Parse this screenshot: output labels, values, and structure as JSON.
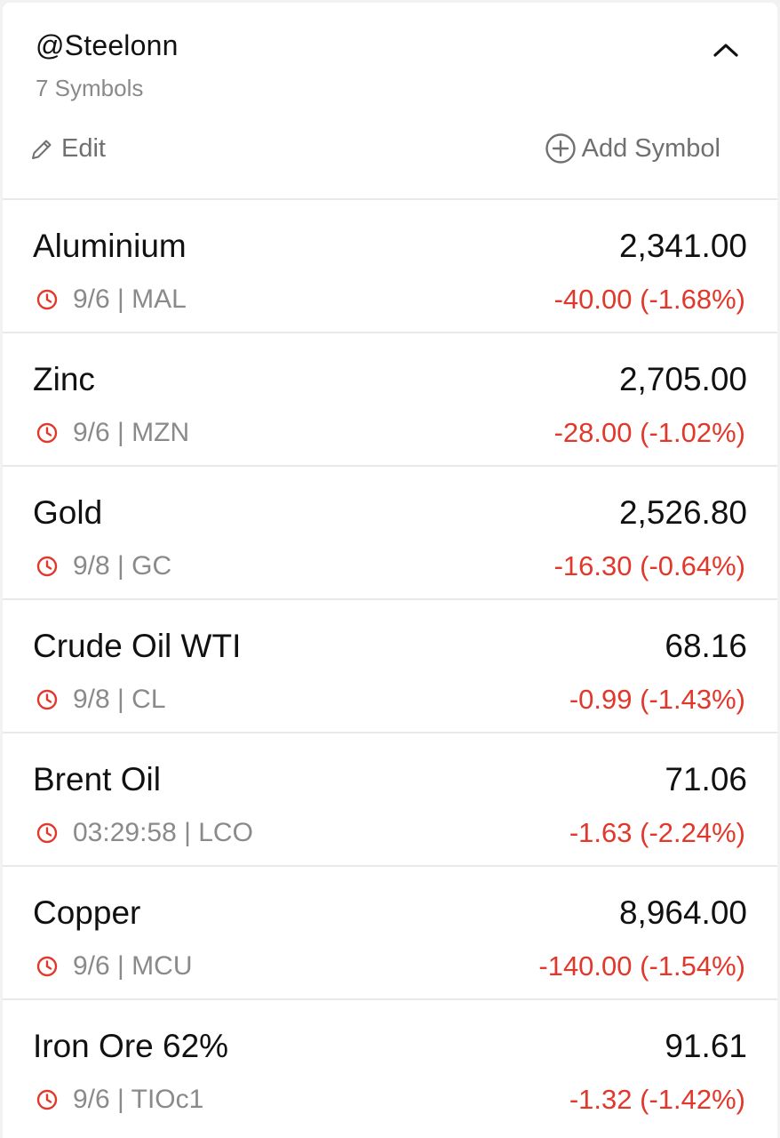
{
  "watchlist": {
    "name": "@Steelonn",
    "count_label": "7 Symbols",
    "edit_label": "Edit",
    "add_label": "Add Symbol",
    "collapse_icon": "chevron-up-icon"
  },
  "colors": {
    "negative": "#e2372b",
    "muted": "#8a8a8a",
    "text": "#111111"
  },
  "symbols": [
    {
      "name": "Aluminium",
      "price": "2,341.00",
      "meta": "9/6 | MAL",
      "change": "-40.00 (-1.68%)"
    },
    {
      "name": "Zinc",
      "price": "2,705.00",
      "meta": "9/6 | MZN",
      "change": "-28.00 (-1.02%)"
    },
    {
      "name": "Gold",
      "price": "2,526.80",
      "meta": "9/8 | GC",
      "change": "-16.30 (-0.64%)"
    },
    {
      "name": "Crude Oil WTI",
      "price": "68.16",
      "meta": "9/8 | CL",
      "change": "-0.99 (-1.43%)"
    },
    {
      "name": "Brent Oil",
      "price": "71.06",
      "meta": "03:29:58 | LCO",
      "change": "-1.63 (-2.24%)"
    },
    {
      "name": "Copper",
      "price": "8,964.00",
      "meta": "9/6 | MCU",
      "change": "-140.00 (-1.54%)"
    },
    {
      "name": "Iron Ore 62%",
      "price": "91.61",
      "meta": "9/6 | TIOc1",
      "change": "-1.32 (-1.42%)"
    }
  ]
}
